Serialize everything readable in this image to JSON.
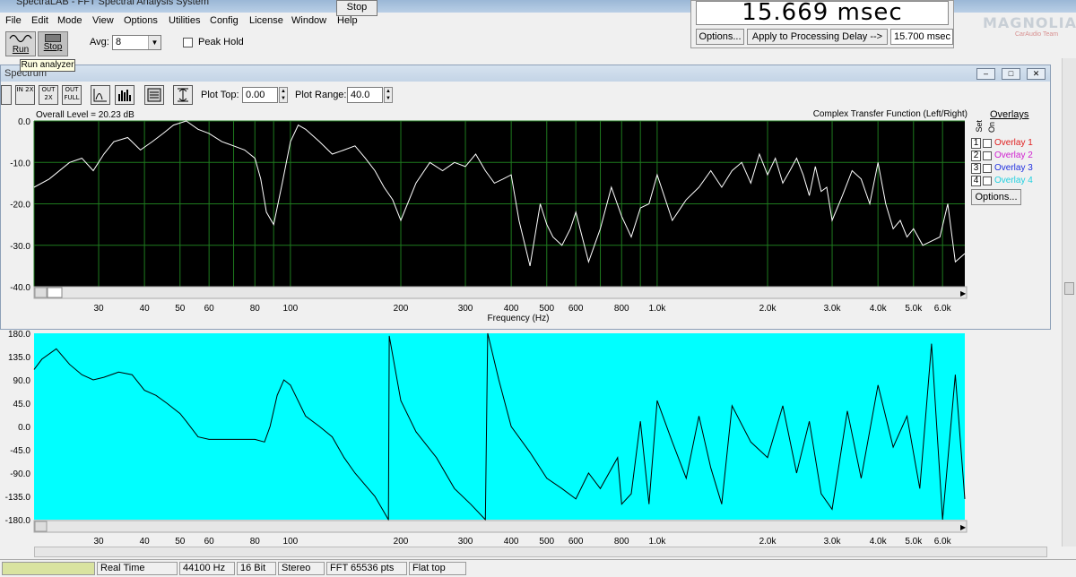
{
  "window": {
    "title": "SpectraLAB - FFT Spectral Analysis System"
  },
  "menu": [
    "File",
    "Edit",
    "Mode",
    "View",
    "Options",
    "Utilities",
    "Config",
    "License",
    "Window",
    "Help"
  ],
  "delay_widget": {
    "stop_label": "Stop",
    "display_value": "15.669 msec",
    "options_label": "Options...",
    "apply_label": "Apply to Processing Delay -->",
    "delay_value": "15.700 msec"
  },
  "logo": {
    "text": "MAGNOLIA",
    "subtext": "CarAudio Team"
  },
  "toolbar": {
    "run_label": "Run",
    "stop_label": "Stop",
    "tooltip": "Run analyzer",
    "avg_label": "Avg:",
    "avg_value": "8",
    "peak_hold_label": "Peak Hold"
  },
  "spectrum_window": {
    "title": "Spectrum",
    "buttons": [
      "IN 2X",
      "OUT 2X",
      "OUT FULL"
    ],
    "plot_top_label": "Plot Top:",
    "plot_top_value": "0.00",
    "plot_range_label": "Plot Range:",
    "plot_range_value": "40.0",
    "overall_level": "Overall Level = 20.23 dB",
    "plot_title": "Complex Transfer Function (Left/Right)",
    "x_axis_label": "Frequency (Hz)"
  },
  "overlays": {
    "title": "Overlays",
    "set_label": "Set",
    "on_label": "On",
    "items": [
      {
        "num": "1",
        "label": "Overlay 1",
        "color": "#e02020"
      },
      {
        "num": "2",
        "label": "Overlay 2",
        "color": "#d020d0"
      },
      {
        "num": "3",
        "label": "Overlay 3",
        "color": "#2030e0"
      },
      {
        "num": "4",
        "label": "Overlay 4",
        "color": "#20d0e0"
      }
    ],
    "options_label": "Options..."
  },
  "status_bar": {
    "cells": [
      "Real Time",
      "44100 Hz",
      "16 Bit",
      "Stereo",
      "FFT 65536 pts",
      "Flat top"
    ]
  },
  "chart_data": [
    {
      "type": "line",
      "title": "Complex Transfer Function (Left/Right)",
      "xlabel": "Frequency (Hz)",
      "ylabel": "",
      "x_scale": "log",
      "xlim": [
        20,
        6900
      ],
      "ylim": [
        -40,
        0
      ],
      "background": "#000000",
      "line_color": "#ffffff",
      "grid_color": "#1e7a1e",
      "grid": true,
      "y_ticks": [
        "0.0",
        "-10.0",
        "-20.0",
        "-30.0",
        "-40.0"
      ],
      "x_ticks": [
        "30",
        "40",
        "50",
        "60",
        "80",
        "100",
        "200",
        "300",
        "400",
        "500",
        "600",
        "800",
        "1.0k",
        "2.0k",
        "3.0k",
        "4.0k",
        "5.0k",
        "6.0k"
      ],
      "series": [
        {
          "x": [
            20,
            22,
            25,
            27,
            29,
            31,
            33,
            36,
            39,
            42,
            45,
            48,
            52,
            56,
            60,
            65,
            70,
            75,
            80,
            83,
            86,
            90,
            95,
            100,
            105,
            110,
            120,
            130,
            140,
            150,
            160,
            170,
            180,
            190,
            200,
            220,
            240,
            260,
            280,
            300,
            320,
            340,
            360,
            380,
            400,
            420,
            450,
            480,
            500,
            520,
            550,
            580,
            600,
            650,
            700,
            750,
            800,
            850,
            900,
            950,
            1000,
            1100,
            1200,
            1300,
            1400,
            1500,
            1600,
            1700,
            1800,
            1900,
            2000,
            2100,
            2200,
            2300,
            2400,
            2500,
            2600,
            2700,
            2800,
            2900,
            3000,
            3200,
            3400,
            3600,
            3800,
            4000,
            4200,
            4400,
            4600,
            4800,
            5000,
            5300,
            5600,
            5900,
            6200,
            6500,
            6900
          ],
          "y": [
            -16,
            -14,
            -10,
            -9,
            -12,
            -8,
            -5,
            -4,
            -7,
            -5,
            -3,
            -1,
            0,
            -2,
            -3,
            -5,
            -6,
            -7,
            -9,
            -14,
            -22,
            -25,
            -15,
            -5,
            -1,
            -2,
            -5,
            -8,
            -7,
            -6,
            -9,
            -12,
            -16,
            -19,
            -24,
            -15,
            -10,
            -12,
            -10,
            -11,
            -8,
            -12,
            -15,
            -14,
            -13,
            -24,
            -35,
            -20,
            -25,
            -28,
            -30,
            -26,
            -22,
            -34,
            -26,
            -16,
            -23,
            -28,
            -21,
            -20,
            -13,
            -24,
            -19,
            -16,
            -12,
            -16,
            -12,
            -10,
            -15,
            -8,
            -13,
            -9,
            -15,
            -12,
            -9,
            -13,
            -18,
            -11,
            -17,
            -16,
            -24,
            -18,
            -12,
            -14,
            -20,
            -10,
            -20,
            -26,
            -24,
            -28,
            -26,
            -30,
            -29,
            -28,
            -20,
            -34,
            -32
          ]
        }
      ]
    },
    {
      "type": "line",
      "title": "",
      "xlabel": "",
      "ylabel": "",
      "x_scale": "log",
      "xlim": [
        20,
        6900
      ],
      "ylim": [
        -180,
        180
      ],
      "background": "#00ffff",
      "line_color": "#000000",
      "grid": false,
      "y_ticks": [
        "180.0",
        "135.0",
        "90.0",
        "45.0",
        "0.0",
        "-45.0",
        "-90.0",
        "-135.0",
        "-180.0"
      ],
      "x_ticks": [
        "30",
        "40",
        "50",
        "60",
        "80",
        "100",
        "200",
        "300",
        "400",
        "500",
        "600",
        "800",
        "1.0k",
        "2.0k",
        "3.0k",
        "4.0k",
        "5.0k",
        "6.0k"
      ],
      "series": [
        {
          "x": [
            20,
            21,
            23,
            25,
            27,
            29,
            31,
            34,
            37,
            40,
            43,
            46,
            50,
            52,
            56,
            60,
            65,
            70,
            75,
            80,
            85,
            88,
            92,
            96,
            100,
            110,
            120,
            130,
            140,
            150,
            170,
            185,
            186,
            200,
            220,
            250,
            280,
            310,
            340,
            345,
            370,
            400,
            450,
            500,
            550,
            600,
            650,
            700,
            780,
            800,
            850,
            900,
            950,
            1000,
            1100,
            1200,
            1300,
            1400,
            1500,
            1600,
            1800,
            2000,
            2200,
            2400,
            2600,
            2800,
            3000,
            3300,
            3600,
            4000,
            4400,
            4800,
            5200,
            5600,
            6000,
            6500,
            6900
          ],
          "y": [
            110,
            130,
            150,
            120,
            100,
            90,
            95,
            105,
            100,
            70,
            60,
            45,
            25,
            10,
            -20,
            -25,
            -25,
            -25,
            -25,
            -25,
            -30,
            0,
            60,
            90,
            80,
            20,
            0,
            -20,
            -60,
            -90,
            -135,
            -180,
            175,
            50,
            -10,
            -60,
            -120,
            -150,
            -180,
            180,
            90,
            0,
            -50,
            -100,
            -120,
            -140,
            -90,
            -120,
            -60,
            -150,
            -130,
            10,
            -150,
            50,
            -30,
            -100,
            20,
            -80,
            -150,
            40,
            -30,
            -60,
            40,
            -90,
            10,
            -130,
            -160,
            30,
            -100,
            80,
            -40,
            20,
            -120,
            160,
            -180,
            100,
            -140
          ]
        }
      ]
    }
  ]
}
